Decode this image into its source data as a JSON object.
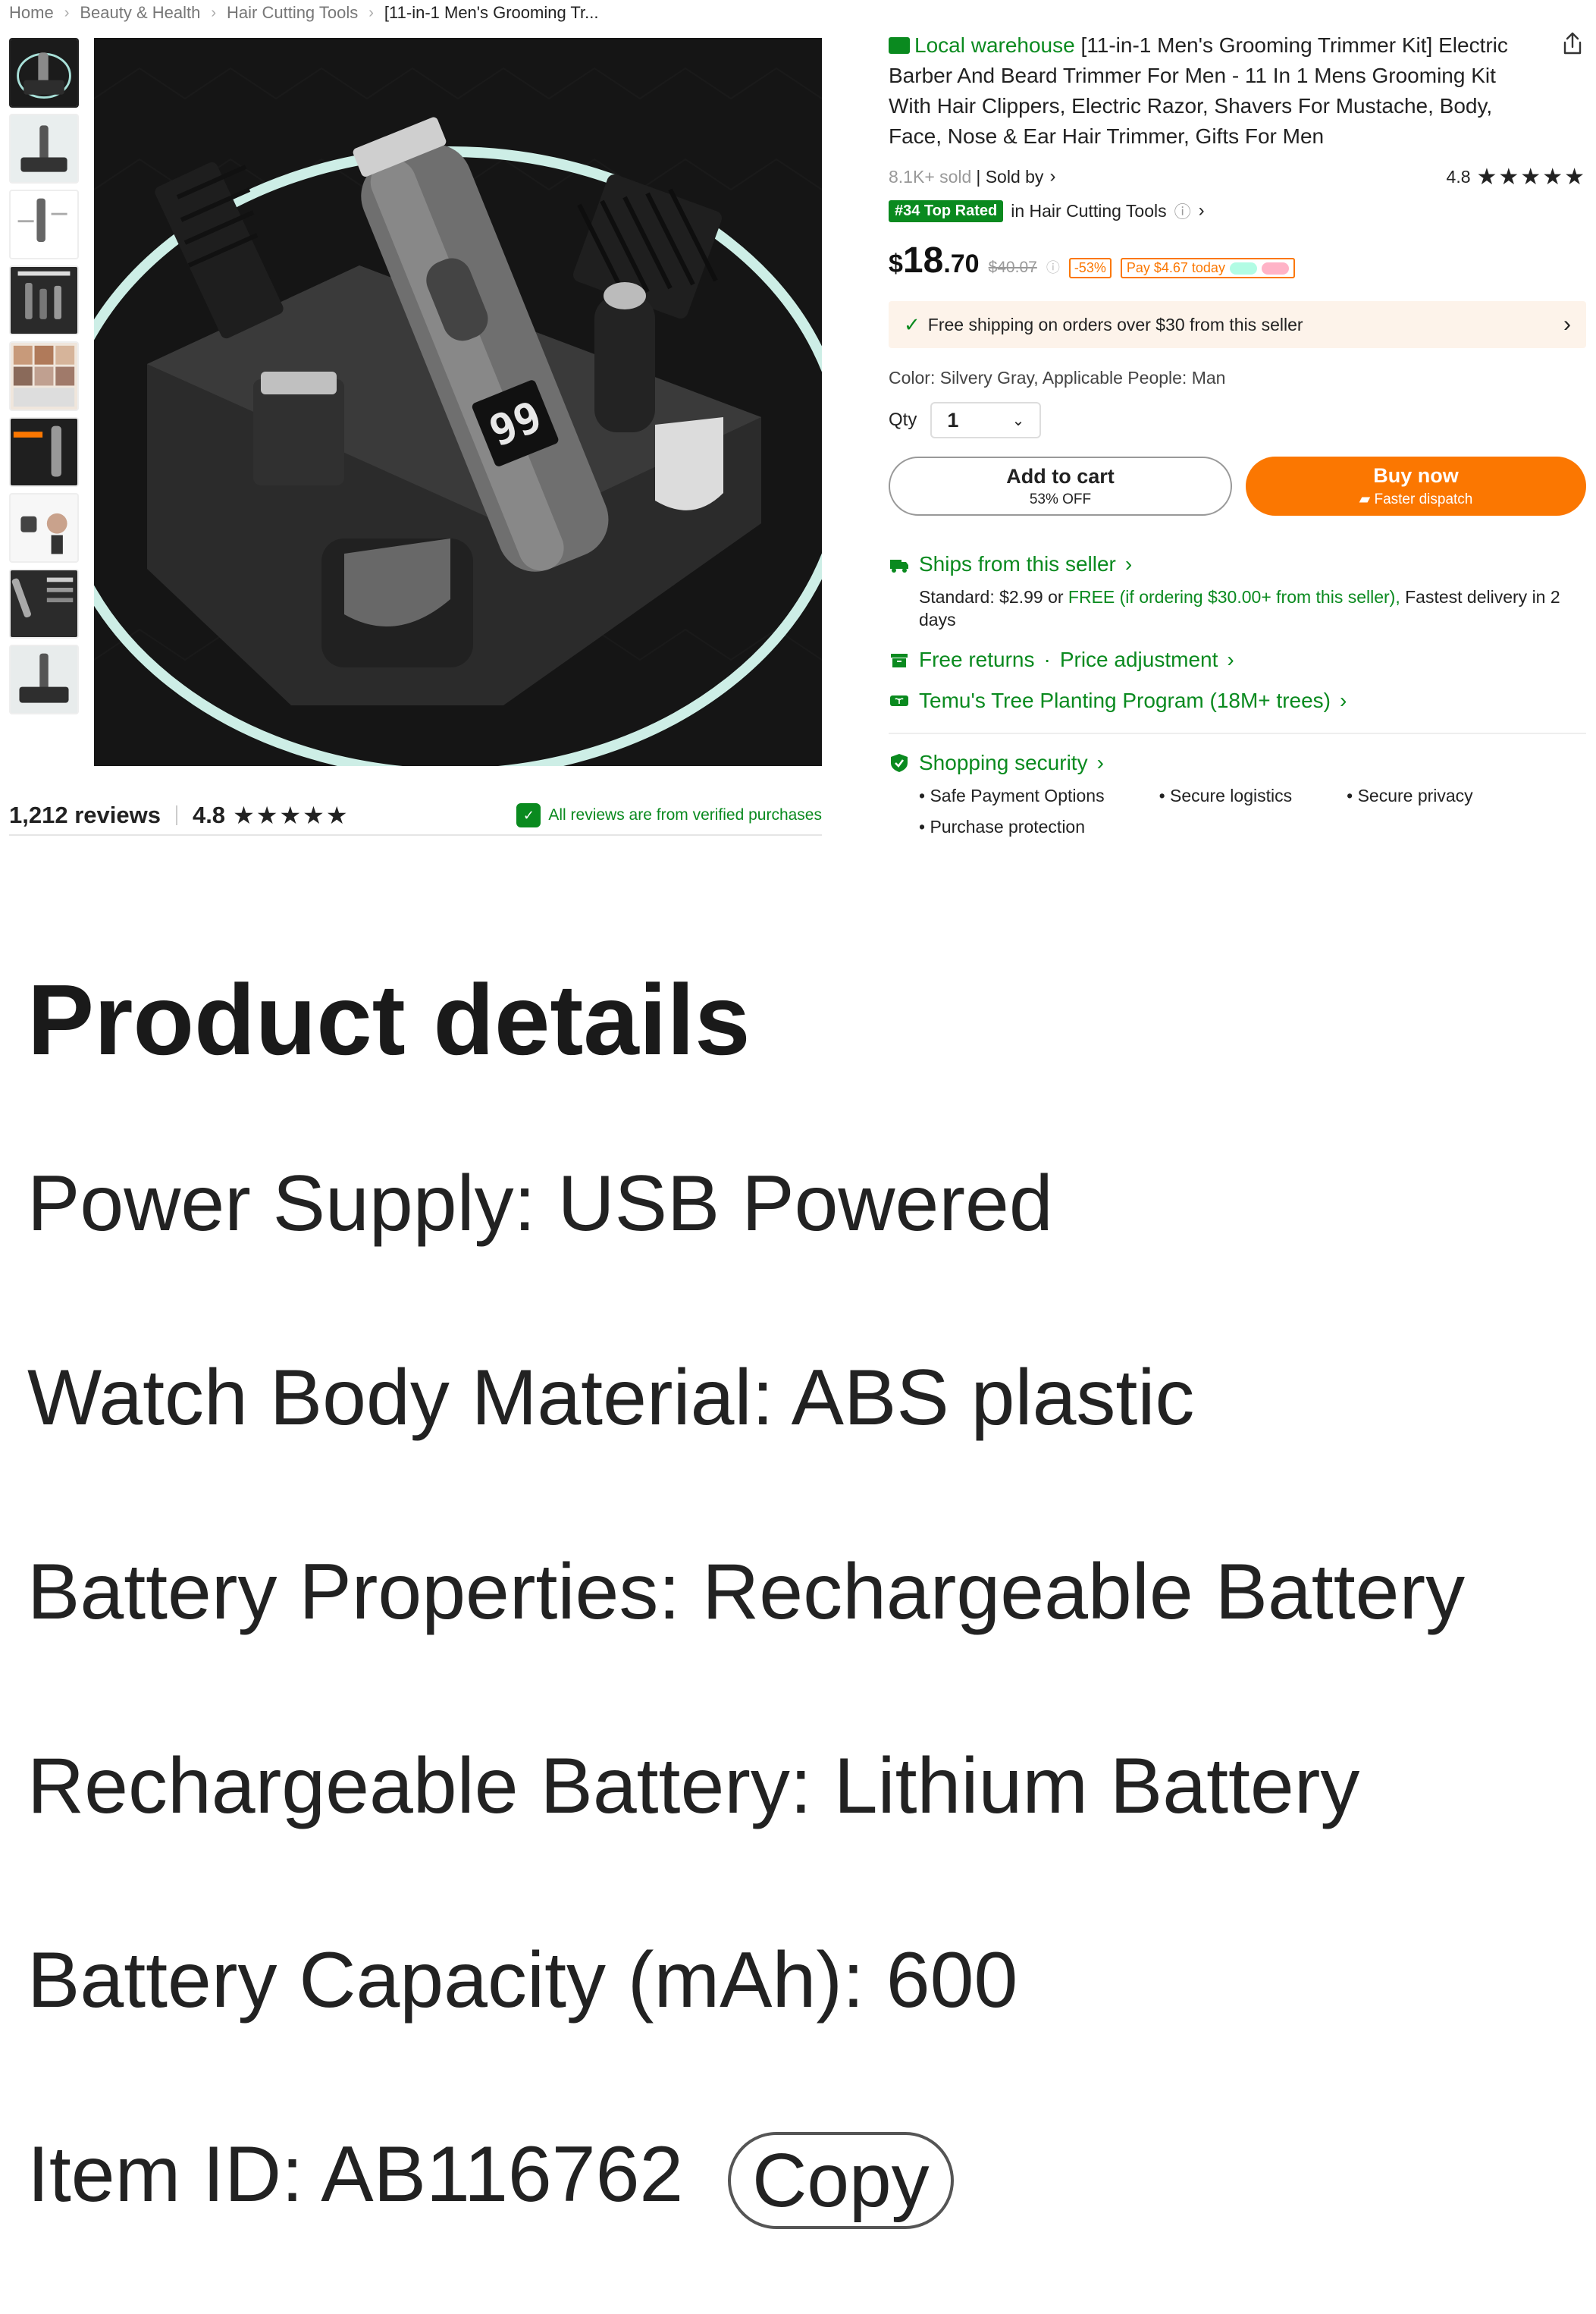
{
  "breadcrumb": {
    "home": "Home",
    "cat1": "Beauty & Health",
    "cat2": "Hair Cutting Tools",
    "current": "[11-in-1 Men's Grooming Tr..."
  },
  "gallery": {
    "thumbnail_count": 9,
    "active_index": 0,
    "main_display_text": "99"
  },
  "reviews": {
    "count_label": "1,212 reviews",
    "rating": "4.8",
    "stars": "★★★★★",
    "verified_label": "All reviews are from verified purchases"
  },
  "product": {
    "warehouse_label": "Local warehouse",
    "title": "[11-in-1 Men's Grooming Trimmer Kit] Electric Barber And Beard Trimmer For Men - 11 In 1 Mens Grooming Kit With Hair Clippers, Electric Razor, Shavers For Mustache, Body, Face, Nose & Ear Hair Trimmer, Gifts For Men",
    "sold": "8.1K+ sold",
    "sold_by": "| Sold by",
    "rating": "4.8",
    "stars": "★★★★★",
    "top_rated_badge": "#34 Top Rated",
    "top_rated_category": "in Hair Cutting Tools",
    "price_currency": "$",
    "price_int": "18",
    "price_dec": ".70",
    "price_old": "$40.07",
    "discount": "-53%",
    "pay_today": "Pay $4.67 today",
    "shipping_banner": "Free shipping on orders over $30 from this seller",
    "attributes": "Color: Silvery Gray, Applicable People: Man",
    "qty_label": "Qty",
    "qty_value": "1"
  },
  "buttons": {
    "add_to_cart": "Add to cart",
    "add_to_cart_sub": "53% OFF",
    "buy_now": "Buy now",
    "buy_now_sub": "Faster dispatch"
  },
  "shipping": {
    "ships_from": "Ships from this seller",
    "standard": "Standard: $2.99 or",
    "free_text": "FREE (if ordering $30.00+ from this seller),",
    "fastest": "Fastest delivery in 2 days",
    "returns": "Free returns",
    "dot": "·",
    "price_adjust": "Price adjustment",
    "tree": "Temu's Tree Planting Program (18M+ trees)"
  },
  "security": {
    "title": "Shopping security",
    "items": [
      "Safe Payment Options",
      "Secure logistics",
      "Secure privacy",
      "Purchase protection"
    ]
  },
  "details": {
    "title": "Product details",
    "lines": [
      "Power Supply: USB Powered",
      "Watch Body Material: ABS plastic",
      "Battery Properties: Rechargeable Battery",
      "Rechargeable Battery: Lithium Battery",
      "Battery Capacity (mAh): 600"
    ],
    "item_id": "Item ID: AB116762",
    "copy_label": "Copy"
  },
  "colors": {
    "brand_green": "#0a8a1f",
    "brand_orange": "#fb7701"
  }
}
